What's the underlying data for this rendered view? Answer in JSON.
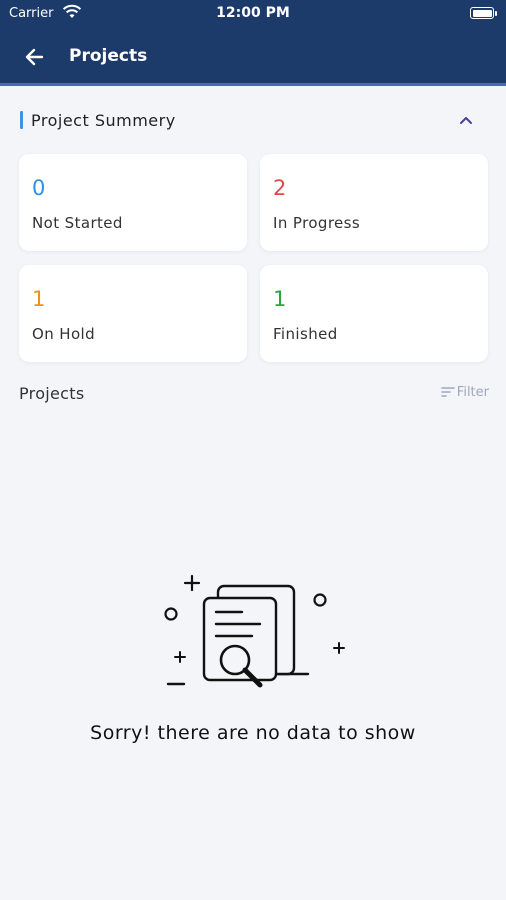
{
  "status_bar": {
    "carrier": "Carrier",
    "time": "12:00 PM"
  },
  "header": {
    "title": "Projects"
  },
  "summary": {
    "title": "Project Summery",
    "cards": [
      {
        "value": "0",
        "label": "Not Started",
        "color": "#2f8fe5"
      },
      {
        "value": "2",
        "label": "In Progress",
        "color": "#e34848"
      },
      {
        "value": "1",
        "label": "On Hold",
        "color": "#f0901c"
      },
      {
        "value": "1",
        "label": "Finished",
        "color": "#2aa63f"
      }
    ]
  },
  "projects": {
    "label": "Projects",
    "filter_label": "Filter"
  },
  "empty_state": {
    "message": "Sorry! there are no data to show",
    "icon": "document-search-icon"
  },
  "colors": {
    "header_bg": "#1d3b6a",
    "accent": "#3a94e8",
    "page_bg": "#f4f5f9"
  }
}
